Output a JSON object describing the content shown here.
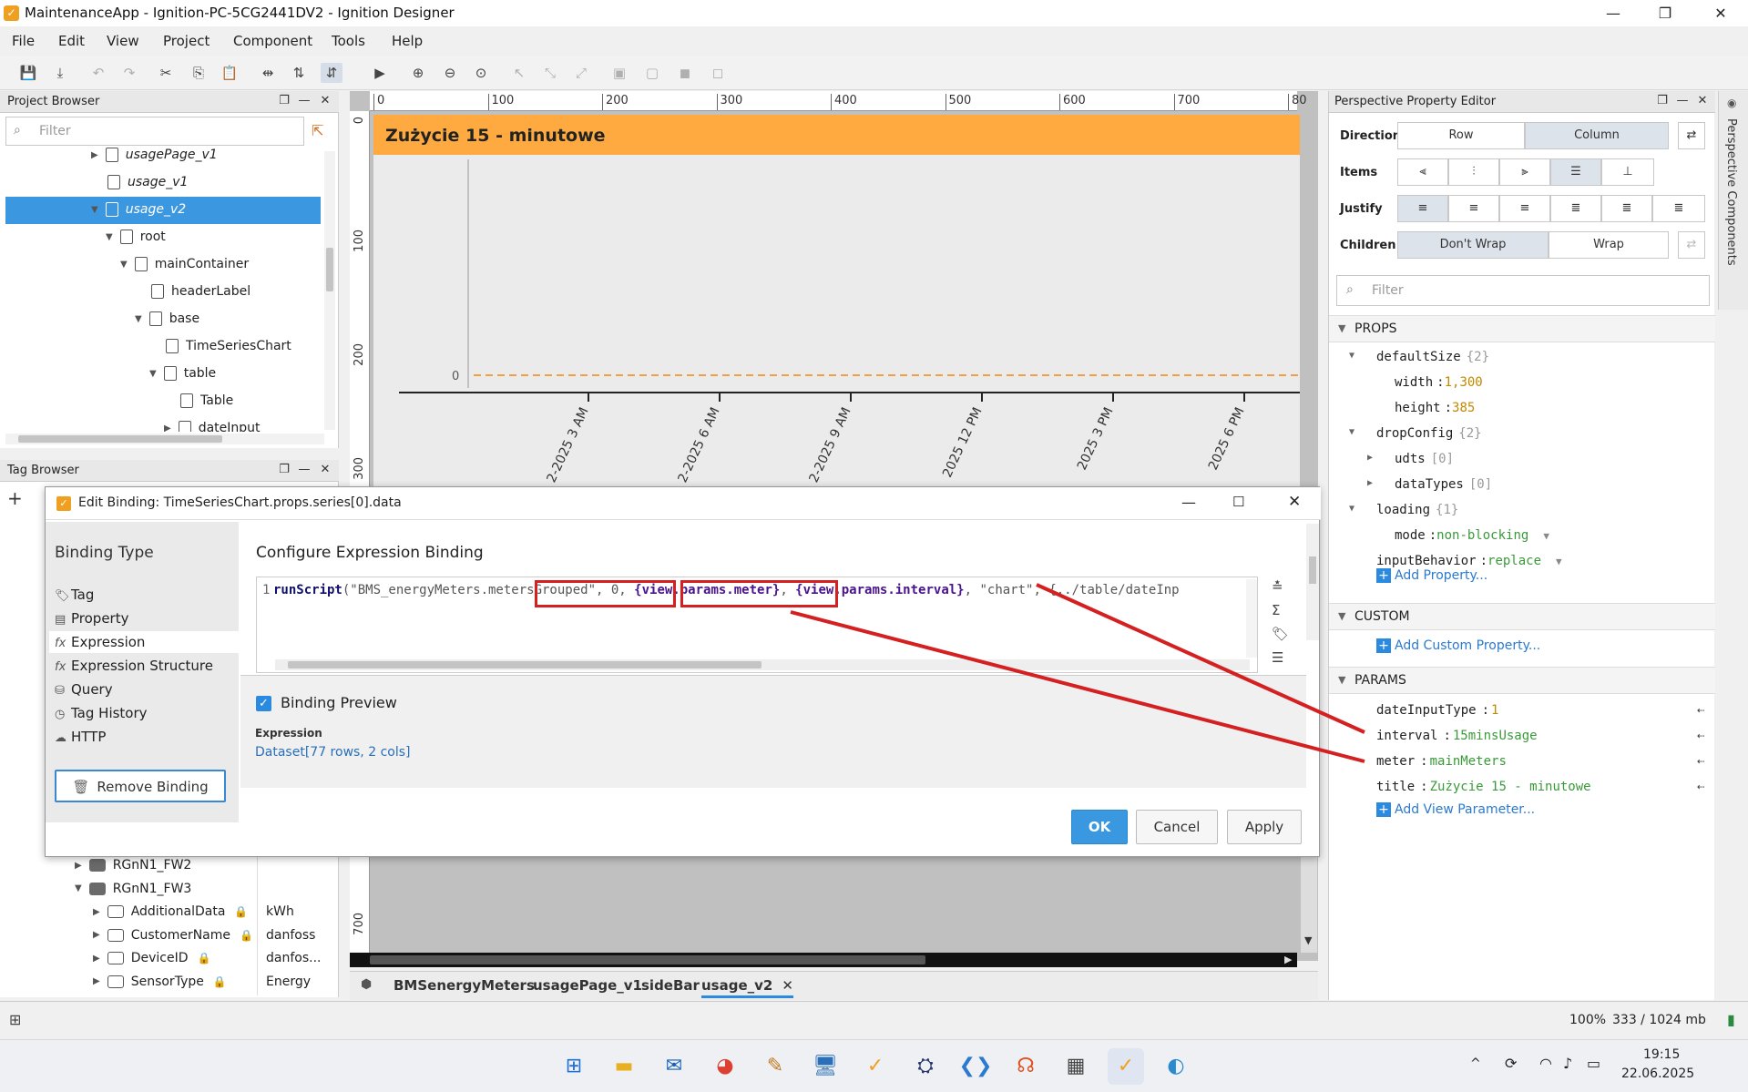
{
  "window": {
    "title": "MaintenanceApp - Ignition-PC-5CG2441DV2 - Ignition Designer"
  },
  "menu": [
    "File",
    "Edit",
    "View",
    "Project",
    "Component",
    "Tools",
    "Help"
  ],
  "project_browser": {
    "title": "Project Browser",
    "filter_placeholder": "Filter",
    "rows": [
      {
        "label": "usagePage_v1",
        "level": 6,
        "arrow": "right",
        "italic": true
      },
      {
        "label": "usage_v1",
        "level": 6,
        "arrow": "",
        "italic": true
      },
      {
        "label": "usage_v2",
        "level": 6,
        "arrow": "down",
        "italic": true,
        "selected": true
      },
      {
        "label": "root",
        "level": 7,
        "arrow": "down"
      },
      {
        "label": "mainContainer",
        "level": 8,
        "arrow": "down"
      },
      {
        "label": "headerLabel",
        "level": 9,
        "arrow": ""
      },
      {
        "label": "base",
        "level": 9,
        "arrow": "down"
      },
      {
        "label": "TimeSeriesChart",
        "level": 10,
        "arrow": ""
      },
      {
        "label": "table",
        "level": 10,
        "arrow": "down"
      },
      {
        "label": "Table",
        "level": 11,
        "arrow": ""
      },
      {
        "label": "dateInput",
        "level": 11,
        "arrow": "right"
      }
    ]
  },
  "tag_browser": {
    "title": "Tag Browser",
    "rows": [
      {
        "label": "RGnN1_FW2",
        "value": "",
        "level": 1,
        "arrow": "right",
        "type": "folder"
      },
      {
        "label": "RGnN1_FW3",
        "value": "",
        "level": 1,
        "arrow": "down",
        "type": "folder"
      },
      {
        "label": "AdditionalData",
        "value": "kWh",
        "level": 2,
        "arrow": "right",
        "type": "tag"
      },
      {
        "label": "CustomerName",
        "value": "danfoss",
        "level": 2,
        "arrow": "right",
        "type": "tag"
      },
      {
        "label": "DeviceID",
        "value": "danfos...",
        "level": 2,
        "arrow": "right",
        "type": "tag"
      },
      {
        "label": "SensorType",
        "value": "Energy",
        "level": 2,
        "arrow": "right",
        "type": "tag"
      }
    ]
  },
  "canvas": {
    "ruler_h": [
      "0",
      "100",
      "200",
      "300",
      "400",
      "500",
      "600",
      "700",
      "80"
    ],
    "ruler_v": [
      "0",
      "100",
      "200",
      "300",
      "700"
    ],
    "header": "Zużycie 15 - minutowe",
    "header_color": "#ffaa40",
    "y_tick": "0",
    "x_ticks": [
      "2-2025 3 AM",
      "2-2025 6 AM",
      "2-2025 9 AM",
      "2025 12 PM",
      "2025 3 PM",
      "2025 6 PM"
    ],
    "tabs": [
      "BMSenergyMeters",
      "usagePage_v1",
      "sideBar",
      "usage_v2"
    ]
  },
  "dialog": {
    "title": "Edit Binding: TimeSeriesChart.props.series[0].data",
    "binding_type_label": "Binding Type",
    "types": [
      "Tag",
      "Property",
      "Expression",
      "Expression Structure",
      "Query",
      "Tag History",
      "HTTP"
    ],
    "selected_type": "Expression",
    "remove_label": "Remove Binding",
    "config_title": "Configure Expression Binding",
    "line_no": "1",
    "code": {
      "fn": "runScript",
      "p1": "(\"BMS_energyMeters.metersGrouped\", 0, ",
      "meter": "{view.params.meter}",
      "sep": ", ",
      "interval": "{view.params.interval}",
      "p2": ", \"chart\", {../table/dateInp"
    },
    "preview_label": "Binding Preview",
    "preview_kind": "Expression",
    "preview_value": "Dataset[77 rows, 2 cols]",
    "buttons": {
      "ok": "OK",
      "cancel": "Cancel",
      "apply": "Apply"
    }
  },
  "property_editor": {
    "title": "Perspective Property Editor",
    "side_tab": "Perspective Components",
    "direction": {
      "label": "Direction",
      "options": [
        "Row",
        "Column"
      ],
      "selected": "Column"
    },
    "items_label": "Items",
    "justify_label": "Justify",
    "children": {
      "label": "Children",
      "options": [
        "Don't Wrap",
        "Wrap"
      ],
      "selected": "Don't Wrap"
    },
    "filter_placeholder": "Filter",
    "sections": {
      "props": "PROPS",
      "custom": "CUSTOM",
      "params": "PARAMS"
    },
    "props": [
      {
        "key": "defaultSize",
        "meta": "{2}",
        "indent": 1,
        "arrow": "down"
      },
      {
        "key": "width",
        "value": "1,300",
        "indent": 2
      },
      {
        "key": "height",
        "value": "385",
        "indent": 2
      },
      {
        "key": "dropConfig",
        "meta": "{2}",
        "indent": 1,
        "arrow": "down"
      },
      {
        "key": "udts",
        "meta": "[0]",
        "indent": 2,
        "arrow": "right"
      },
      {
        "key": "dataTypes",
        "meta": "[0]",
        "indent": 2,
        "arrow": "right"
      },
      {
        "key": "loading",
        "meta": "{1}",
        "indent": 1,
        "arrow": "down"
      },
      {
        "key": "mode",
        "value": "non-blocking",
        "indent": 2,
        "green": true,
        "dropdown": true
      },
      {
        "key": "inputBehavior",
        "value": "replace",
        "indent": 1,
        "green": true,
        "dropdown": true
      }
    ],
    "add_property": "Add Property...",
    "add_custom": "Add Custom Property...",
    "params": [
      {
        "key": "dateInputType",
        "value": "1"
      },
      {
        "key": "interval",
        "value": "15minsUsage"
      },
      {
        "key": "meter",
        "value": "mainMeters"
      },
      {
        "key": "title",
        "value": "Zużycie 15 - minutowe"
      }
    ],
    "add_param": "Add View Parameter..."
  },
  "status": {
    "zoom": "100%",
    "memory": "333 / 1024 mb"
  },
  "taskbar": {
    "time": "19:15",
    "date": "22.06.2025"
  }
}
